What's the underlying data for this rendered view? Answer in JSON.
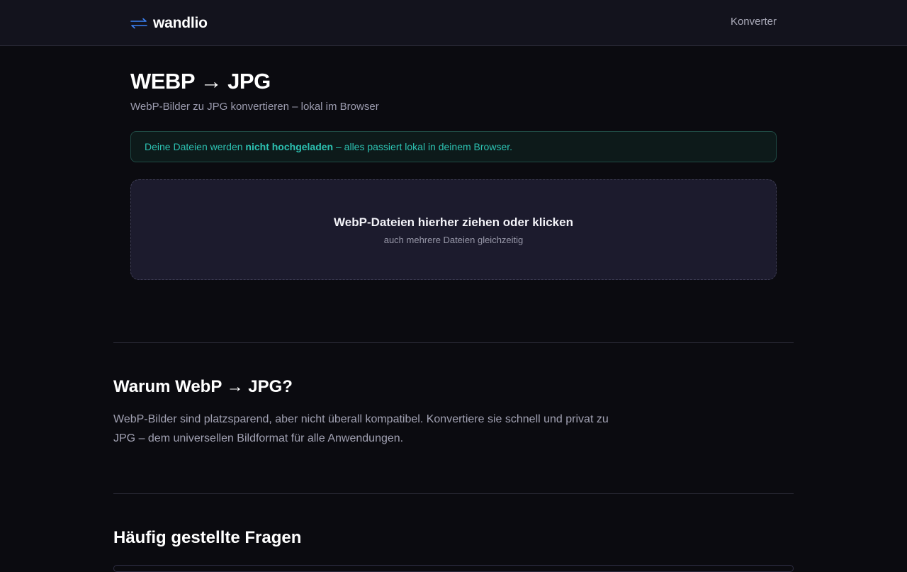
{
  "header": {
    "brand": "wandlio",
    "nav_link": "Konverter"
  },
  "hero": {
    "title": "WEBP → JPG",
    "subtitle": "WebP-Bilder zu JPG konvertieren – lokal im Browser"
  },
  "privacy_notice": {
    "before": "Deine Dateien werden ",
    "bold": "nicht hochgeladen",
    "after": " – alles passiert lokal in deinem Browser."
  },
  "dropzone": {
    "title": "WebP-Dateien hierher ziehen oder klicken",
    "subtitle": "auch mehrere Dateien gleichzeitig"
  },
  "why_section": {
    "heading": "Warum WebP → JPG?",
    "text": "WebP-Bilder sind platzsparend, aber nicht überall kompatibel. Konvertiere sie schnell und privat zu JPG – dem universellen Bildformat für alle Anwendungen."
  },
  "faq_section": {
    "heading": "Häufig gestellte Fragen"
  },
  "icons": {
    "brand": "swap-arrows-icon"
  },
  "colors": {
    "background": "#0b0b10",
    "header_background": "#13131d",
    "accent_blue": "#3b82f6",
    "privacy_teal": "#2cc2b2",
    "dropzone_background": "#1c1b2d"
  }
}
